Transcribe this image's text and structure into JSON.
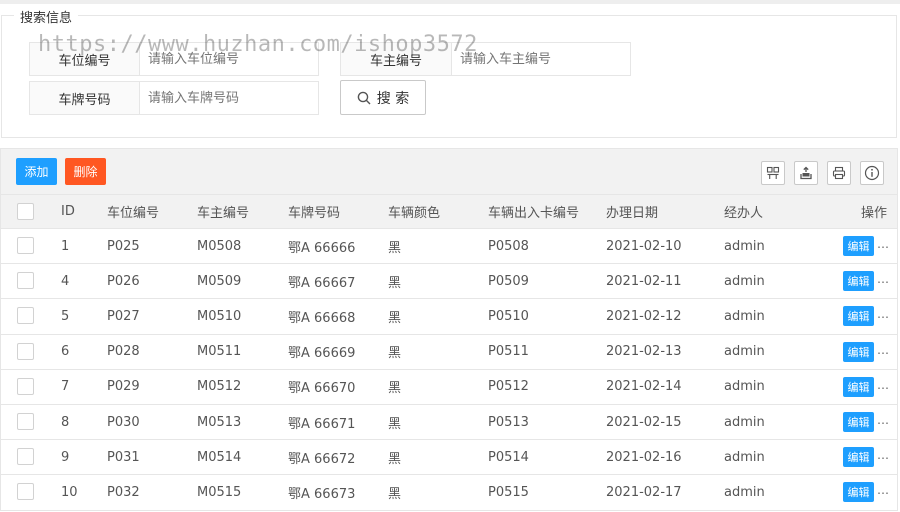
{
  "search": {
    "legend": "搜索信息",
    "fields": [
      {
        "label": "车位编号",
        "placeholder": "请输入车位编号"
      },
      {
        "label": "车主编号",
        "placeholder": "请输入车主编号"
      },
      {
        "label": "车牌号码",
        "placeholder": "请输入车牌号码"
      }
    ],
    "button_label": "搜 索"
  },
  "watermark": "https://www.huzhan.com/ishop3572",
  "toolbar": {
    "add_label": "添加",
    "delete_label": "删除",
    "icons": [
      "columns-icon",
      "export-icon",
      "print-icon",
      "info-icon"
    ]
  },
  "table": {
    "headers": [
      "ID",
      "车位编号",
      "车主编号",
      "车牌号码",
      "车辆颜色",
      "车辆出入卡编号",
      "办理日期",
      "经办人",
      "操作"
    ],
    "rows": [
      [
        "1",
        "P025",
        "M0508",
        "鄂A 66666",
        "黑",
        "P0508",
        "2021-02-10",
        "admin"
      ],
      [
        "4",
        "P026",
        "M0509",
        "鄂A 66667",
        "黑",
        "P0509",
        "2021-02-11",
        "admin"
      ],
      [
        "5",
        "P027",
        "M0510",
        "鄂A 66668",
        "黑",
        "P0510",
        "2021-02-12",
        "admin"
      ],
      [
        "6",
        "P028",
        "M0511",
        "鄂A 66669",
        "黑",
        "P0511",
        "2021-02-13",
        "admin"
      ],
      [
        "7",
        "P029",
        "M0512",
        "鄂A 66670",
        "黑",
        "P0512",
        "2021-02-14",
        "admin"
      ],
      [
        "8",
        "P030",
        "M0513",
        "鄂A 66671",
        "黑",
        "P0513",
        "2021-02-15",
        "admin"
      ],
      [
        "9",
        "P031",
        "M0514",
        "鄂A 66672",
        "黑",
        "P0514",
        "2021-02-16",
        "admin"
      ],
      [
        "10",
        "P032",
        "M0515",
        "鄂A 66673",
        "黑",
        "P0515",
        "2021-02-17",
        "admin"
      ]
    ],
    "edit_label": "编辑",
    "more_label": "…"
  },
  "colors": {
    "primary": "#1e9fff",
    "danger": "#ff5722"
  }
}
